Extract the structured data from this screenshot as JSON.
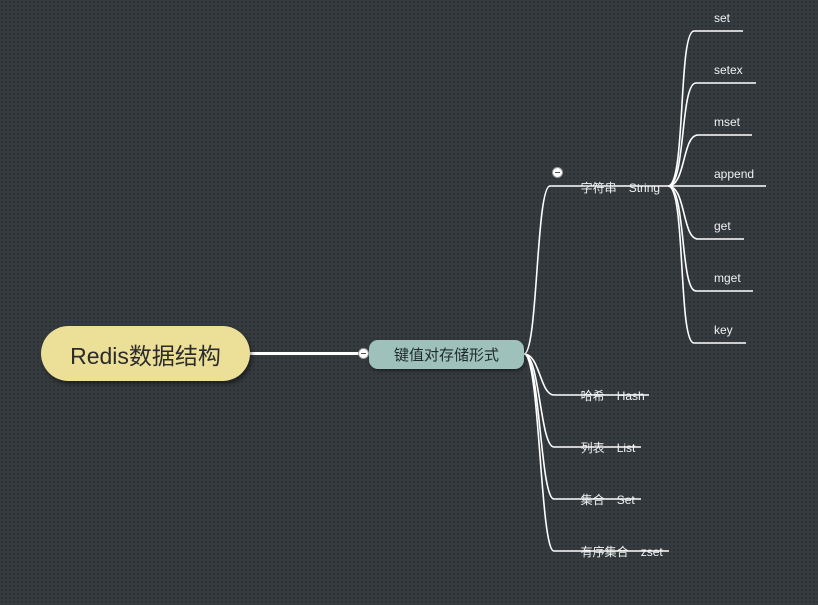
{
  "root": {
    "label": "Redis数据结构"
  },
  "main": {
    "label": "键值对存储形式"
  },
  "types": {
    "string": {
      "label": "字符串",
      "en": "String"
    },
    "hash": {
      "label": "哈希",
      "en": "Hash"
    },
    "list": {
      "label": "列表",
      "en": "List"
    },
    "set": {
      "label": "集合",
      "en": "Set"
    },
    "zset": {
      "label": "有序集合",
      "en": "zset"
    }
  },
  "string_commands": [
    "set",
    "setex",
    "mset",
    "append",
    "get",
    "mget",
    "key"
  ],
  "colors": {
    "background": "#353b3e",
    "root_fill": "#ecdf98",
    "topic_fill": "#9ec1bc",
    "connector": "#ffffff",
    "text": "#f2f2f2"
  }
}
